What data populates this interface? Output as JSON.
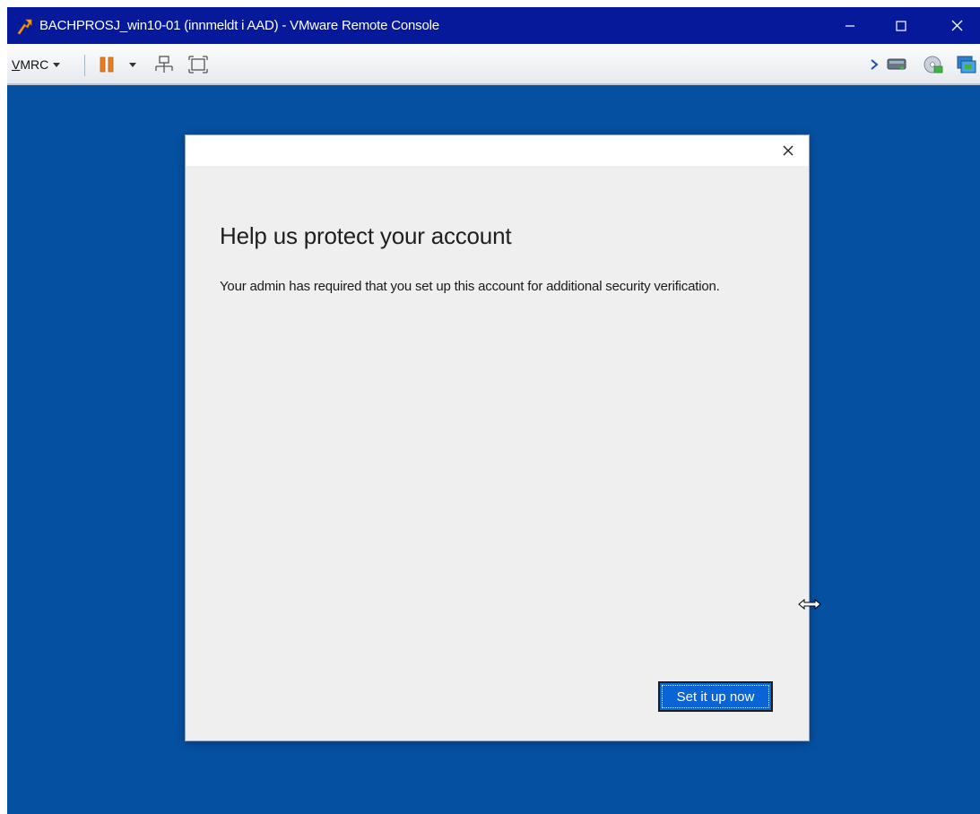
{
  "window": {
    "title": "BACHPROSJ_win10-01 (innmeldt i AAD) - VMware Remote Console",
    "controls": {
      "minimize_icon": "minimize-icon",
      "maximize_icon": "maximize-icon",
      "close_icon": "close-icon"
    },
    "app_icon": "vmware-remote-console-icon",
    "colors": {
      "titlebar": "#06199a",
      "desktop": "#0550a0"
    }
  },
  "toolbar": {
    "vmrc_menu_prefix": "V",
    "vmrc_menu_rest": "MRC",
    "icons": [
      "pause-icon",
      "chevron-down-icon",
      "send-ctrl-alt-del-icon",
      "fullscreen-icon",
      "more-icon",
      "removable-device-icon",
      "cd-dvd-icon",
      "network-adapter-icon"
    ]
  },
  "dialog": {
    "title": "Help us protect your account",
    "message": "Your admin has required that you set up this account for additional security verification.",
    "primary_button": "Set it up now",
    "close_icon": "close-icon",
    "colors": {
      "body": "#efefef",
      "button": "#0a64d6"
    }
  }
}
